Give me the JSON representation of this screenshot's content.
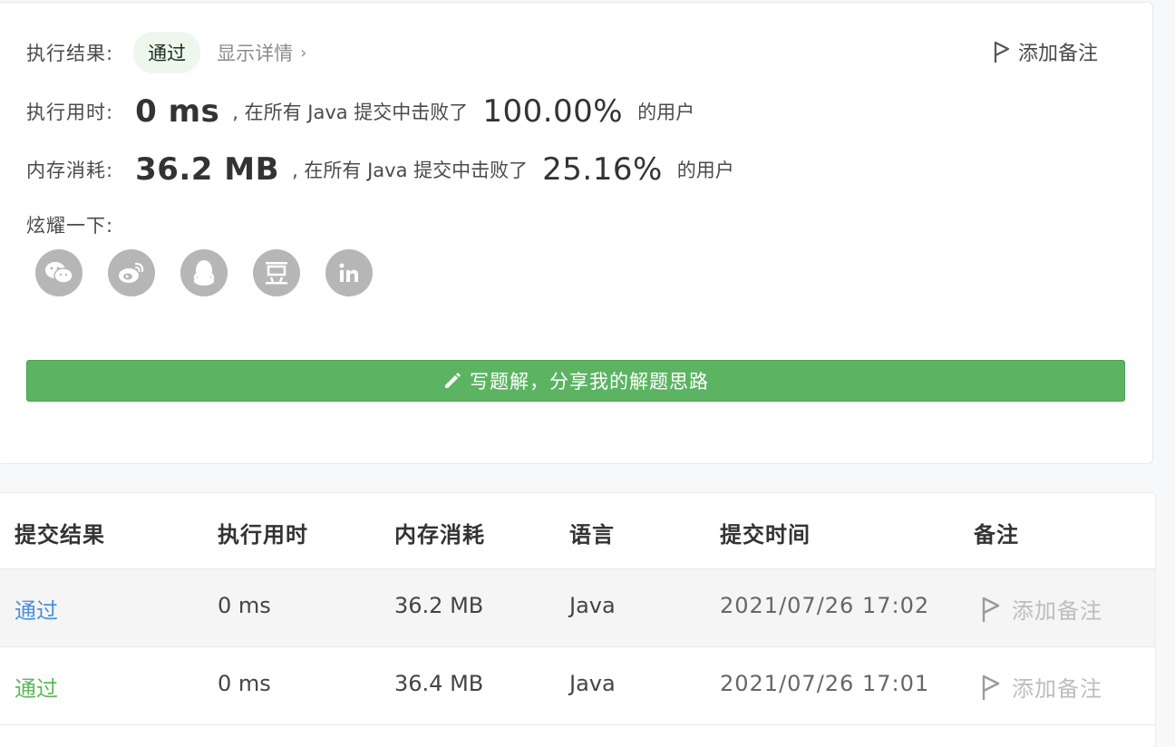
{
  "result": {
    "status_label": "执行结果:",
    "status_value": "通过",
    "detail_link": "显示详情",
    "detail_chevron": "›",
    "add_note": "添加备注",
    "runtime_label": "执行用时:",
    "runtime_value": "0 ms",
    "runtime_mid": ", 在所有 Java 提交中击败了",
    "runtime_pct": "100.00%",
    "runtime_suffix": "的用户",
    "memory_label": "内存消耗:",
    "memory_value": "36.2 MB",
    "memory_mid": ", 在所有 Java 提交中击败了",
    "memory_pct": "25.16%",
    "memory_suffix": "的用户",
    "share_label": "炫耀一下:",
    "share_icons": [
      "wechat-icon",
      "weibo-icon",
      "qq-icon",
      "douban-icon",
      "linkedin-icon"
    ],
    "write_button": "写题解，分享我的解题思路"
  },
  "table": {
    "headers": [
      "提交结果",
      "执行用时",
      "内存消耗",
      "语言",
      "提交时间",
      "备注"
    ],
    "rows": [
      {
        "status": "通过",
        "status_color": "#4a90d9",
        "runtime": "0 ms",
        "memory": "36.2 MB",
        "language": "Java",
        "time": "2021/07/26 17:02",
        "note": "添加备注"
      },
      {
        "status": "通过",
        "status_color": "#5cb85c",
        "runtime": "0 ms",
        "memory": "36.4 MB",
        "language": "Java",
        "time": "2021/07/26 17:01",
        "note": "添加备注"
      }
    ]
  },
  "colors": {
    "accent_green": "#5cb463",
    "link_blue": "#4a90d9",
    "pass_green": "#5cb85c"
  }
}
